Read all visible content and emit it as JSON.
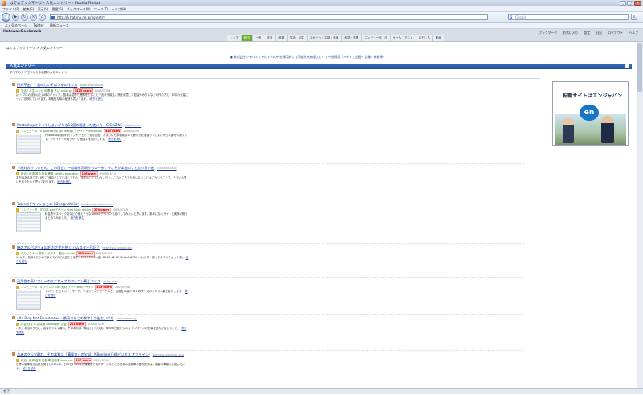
{
  "window": {
    "title": "はてなブックマーク - 人気エントリー - Mozilla Firefox"
  },
  "menu": [
    "ファイル(F)",
    "編集(E)",
    "表示(V)",
    "履歴(S)",
    "ブックマーク(B)",
    "ツール(T)",
    "ヘルプ(H)"
  ],
  "nav": {
    "url": "http://b.hatena.ne.jp/hotentry",
    "search_placeholder": "Google"
  },
  "bookmarks": [
    "よく見るページ",
    "Twitter",
    "最新ニュース"
  ],
  "hatena": {
    "logo": "Hatena::Bookmark",
    "tabs": [
      "トップ",
      "総合",
      "一般",
      "政治",
      "経済",
      "生活・人生",
      "スポーツ・芸能・音楽",
      "科学・学問",
      "コンピュータ・IT",
      "ゲーム・アニメ",
      "おもしろ",
      "動画"
    ],
    "right": [
      "ブックマーク",
      "お気に入り",
      "設定",
      "日記",
      "ログアウト",
      "ヘルプ"
    ]
  },
  "crumb": "はてなブックマーク > 人気エントリー",
  "banner": "■ 株式会社ジャパネットたかたの中途採用求人 | 可能性を無限大に！ | 中途採用（メディア企画・営業・総務系）",
  "section_title": "人気エントリー",
  "subhead": "すべてのカテゴリから今話題の人気エントリー",
  "entries": [
    {
      "title": "門外不出！？美味しいそばつゆの作り方",
      "domain": "www.geocities.jp",
      "tags": "生活・人生  レシピ  料理  食  そば  cooking",
      "users": "1525 users",
      "date": "2009/07/09",
      "desc": "は〜 プロの技術以上の味のギャップ。基本は昆布と鰹節をとることで出汁を取る。鍋を用意して醤油やみりんなどの作り方と、材料の分量について説明していきます。本格的な味の秘訣も書いてます。",
      "more": "続きを読む"
    },
    {
      "title": "Photoshopでやってしまいがちな12個の間違った使い方 : GIGAZINE",
      "domain": "gigazine.net",
      "tags": "コンピュータ・IT  photoshop  tips  design  デザイン  *photoshop",
      "users": "450 users",
      "date": "2009/07/09",
      "desc": "Photoshopは優れたソフトウェアである反面、あまりにも多機能なので使い方を間違ってしまいがちな部分もあります。デザイナーが陥りやすい間違いを紹介します。",
      "more": "続きを読む"
    },
    {
      "title": "『絶対おかしいもん、この国会』～就職氷河期からの一歩', 今こそが本当の', と言う思い出",
      "domain": "d.hatena.ne.jp",
      "tags": "政治・経済  政治  社会  教育  politics  education",
      "users": "106 users",
      "date": "2009/07/10",
      "desc": "本日はある話です。総じて議会をしていましてもう、決定のことというよりも、このところでも言いたいことはこういうことで、そういう思いを伝えたいと思っております。",
      "more": "続きを読む"
    },
    {
      "title": "Tableのデザインまとめ | DesignWalker",
      "domain": "www.designwalker.com",
      "tags": "コンピュータ・IT  CSS  webデザイン  html  table  design",
      "users": "270 users",
      "date": "2009/07/09",
      "desc": "料金表やスペック表などに使えそうなTableのデザインを紹介してみたいと思います。参考になるサイトと実際の例をまとめてみました。",
      "more": "続きを読む"
    },
    {
      "title": "俺のアルバがウォルギ'ださ手を抱く'ハムスター日記 ? ",
      "domain": "news4vip.livedoor.biz",
      "tags": "おもしろ  2ch  動物  ハムスター  動画  animal",
      "users": "361 users",
      "date": "2009/07/09",
      "desc": "1: 以下、名無しにかわりましてVIPがお送りします：2009/07/10(金) 18:22:12.02 ID:AbCdEfG0 ハムスター飼ってるやつちょっと来い",
      "more": "続きを読む"
    },
    {
      "title": "汎用性の高いフリーのミニサイズのアイコン集 | コリス",
      "domain": "coliss.com",
      "tags": "コンピュータ・IT  アイコン  icon  素材  フリー  webデザイン",
      "users": "325 users",
      "date": "2009/07/09",
      "desc": "アロー、ビュレット、サーチ、ショッピングカートなど、汎用性の高い16×16サイズのアイコン集を紹介します。",
      "more": "続きを読む"
    },
    {
      "title": "404 Blog Not Found:news - 最高でもこの数字しか出ないのか",
      "domain": "blog.livedoor.jp",
      "tags": "社会  社会  本  図書館  danbuggir  お金",
      "users": "211 users",
      "date": "2009/07/09",
      "desc": "これ、本当のうちに、若者のクルマ離れ、その本質は「購買力」の欠如、Nikkei日経ビジネス オンラインの記事を読んで感じたこと。",
      "more": "続きを読む"
    },
    {
      "title": "若者のクルマ離れ、その本質は「購買力」の欠如：NBonline(日経ビジネス オンライン)",
      "domain": "business.nikkeibp.co.jp",
      "tags": "政治・経済  経済  社会  車  自動車  business",
      "users": "297 users",
      "date": "2009/07/09",
      "desc": "世界の新車販売台数を見ると2009年、日本を1960年の規模まで待たず、このところ日本の自動車の国内販売は、若者の車離れが進んでいる。",
      "more": "続きを読む"
    }
  ],
  "ad": {
    "title": "転職サイトはエンジャパン",
    "logo": "en"
  },
  "status": "完了"
}
